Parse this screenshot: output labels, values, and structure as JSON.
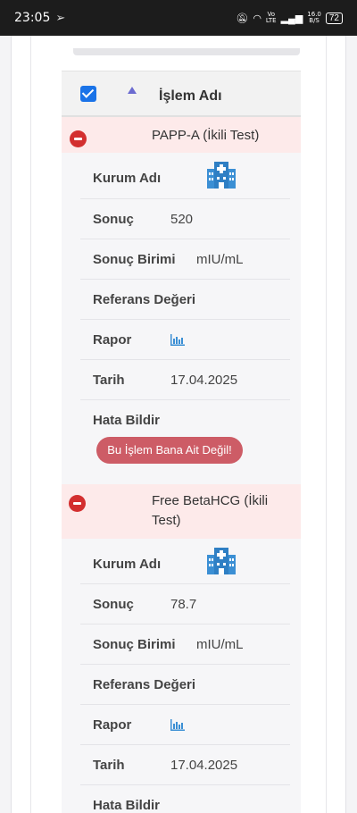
{
  "statusbar": {
    "time": "23:05",
    "net_top": "Vo",
    "net_bottom": "LTE",
    "speed_top": "16.0",
    "speed_bottom": "B/S",
    "battery": "72"
  },
  "table": {
    "header_label": "İşlem Adı",
    "header_checked": true
  },
  "groups": [
    {
      "title": "PAPP-A (İkili Test)",
      "labels": {
        "kurum": "Kurum Adı",
        "sonuc": "Sonuç",
        "birim": "Sonuç Birimi",
        "referans": "Referans Değeri",
        "rapor": "Rapor",
        "tarih": "Tarih",
        "hata": "Hata Bildir"
      },
      "values": {
        "sonuc": "520",
        "birim": "mIU/mL",
        "tarih": "17.04.2025"
      },
      "report_button": "Bu İşlem Bana Ait Değil!"
    },
    {
      "title_line1": "Free BetaHCG (İkili",
      "title_line2": "Test)",
      "labels": {
        "kurum": "Kurum Adı",
        "sonuc": "Sonuç",
        "birim": "Sonuç Birimi",
        "referans": "Referans Değeri",
        "rapor": "Rapor",
        "tarih": "Tarih",
        "hata": "Hata Bildir"
      },
      "values": {
        "sonuc": "78.7",
        "birim": "mIU/mL",
        "tarih": "17.04.2025"
      }
    }
  ],
  "icons": {
    "institution": "hospital-building-icon",
    "report": "bar-chart-icon",
    "collapse": "minus-circle-icon"
  },
  "colors": {
    "accent_blue": "#3b8fd4",
    "danger": "#d32f2f",
    "button": "#cd5c66",
    "group_bg": "#fdeaea"
  }
}
